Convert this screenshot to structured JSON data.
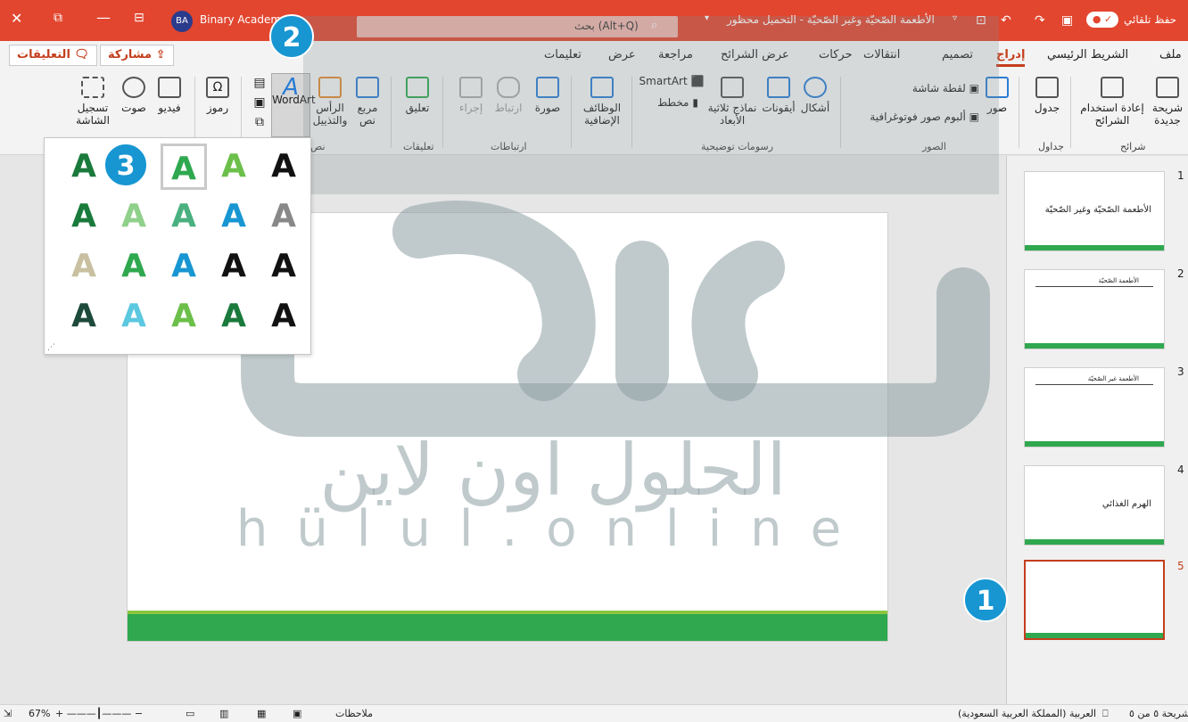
{
  "titlebar": {
    "autosave_label": "حفظ تلقائي",
    "doc_title": "الأطعمة الصّحيّة وغير الصّحيّة  -  التحميل محظور",
    "search_placeholder": "بحث (Alt+Q)",
    "user_initials": "BA",
    "user_name": "Binary Academ",
    "bg_color": "#e2462f"
  },
  "tabs": [
    "ملف",
    "الشريط الرئيسي",
    "إدراج",
    "تصميم",
    "انتقالات",
    "حركات",
    "عرض الشرائح",
    "مراجعة",
    "عرض",
    "تعليمات"
  ],
  "active_tab": "إدراج",
  "share_label": "مشاركة",
  "comments_label": "التعليقات",
  "ribbon": {
    "slides": {
      "new_slide": "شريحة جديدة",
      "reuse": "إعادة استخدام الشرائح",
      "group": "شرائح"
    },
    "tables": {
      "table": "جدول",
      "group": "جداول"
    },
    "images": {
      "pictures": "صور",
      "screenshot": "لقطة شاشة",
      "album": "ألبوم صور فوتوغرافية",
      "group": "الصور"
    },
    "illustrations": {
      "shapes": "أشكال",
      "icons": "أيقونات",
      "models": "نماذج ثلاثية الأبعاد",
      "smartart": "SmartArt",
      "chart": "مخطط",
      "group": "رسومات توضيحية"
    },
    "addins": {
      "label": "الوظائف الإضافية"
    },
    "links": {
      "zoom": "صورة",
      "link": "ارتباط",
      "action": "إجراء",
      "group": "ارتباطات"
    },
    "comments": {
      "comment": "تعليق",
      "group": "تعليقات"
    },
    "text": {
      "textbox": "مربع نص",
      "header": "الرأس والتذييل",
      "wordart": "WordArt",
      "group": "نص"
    },
    "media": {
      "symbols": "رموز",
      "video": "فيديو",
      "audio": "صوت",
      "record": "تسجيل الشاشة"
    }
  },
  "wordart_gallery": {
    "glyph": "A",
    "rows": [
      [
        "#1a7a3c",
        "#2fa84f",
        "#6cbf4a",
        "#111111"
      ],
      [
        "#1a7a3c",
        "#8fd08a",
        "#4ab080",
        "#1796d2"
      ],
      [
        "#c8c0a0",
        "#2fa84f",
        "#1796d2",
        "#111111"
      ],
      [
        "#1d4a3a",
        "#5bc8e0",
        "#6cbf4a",
        "#1a7a3c"
      ]
    ]
  },
  "slides_panel": {
    "items": [
      {
        "num": "1",
        "title": "الأطعمة الصّحيّة وغير الصّحيّة"
      },
      {
        "num": "2",
        "title": "الأطعمة الصّحيّة"
      },
      {
        "num": "3",
        "title": "الأطعمة غير الصّحيّة"
      },
      {
        "num": "4",
        "title": "الهرم الغذائي"
      },
      {
        "num": "5",
        "title": ""
      }
    ]
  },
  "badges": [
    "1",
    "2",
    "3"
  ],
  "watermark": {
    "arabic": "الحلول اون لاين",
    "latin": "hülul.online"
  },
  "statusbar": {
    "slide_info": "شريحة ٥ من ٥",
    "language": "العربية (المملكة العربية السعودية)",
    "notes": "ملاحظات",
    "zoom": "67%"
  }
}
